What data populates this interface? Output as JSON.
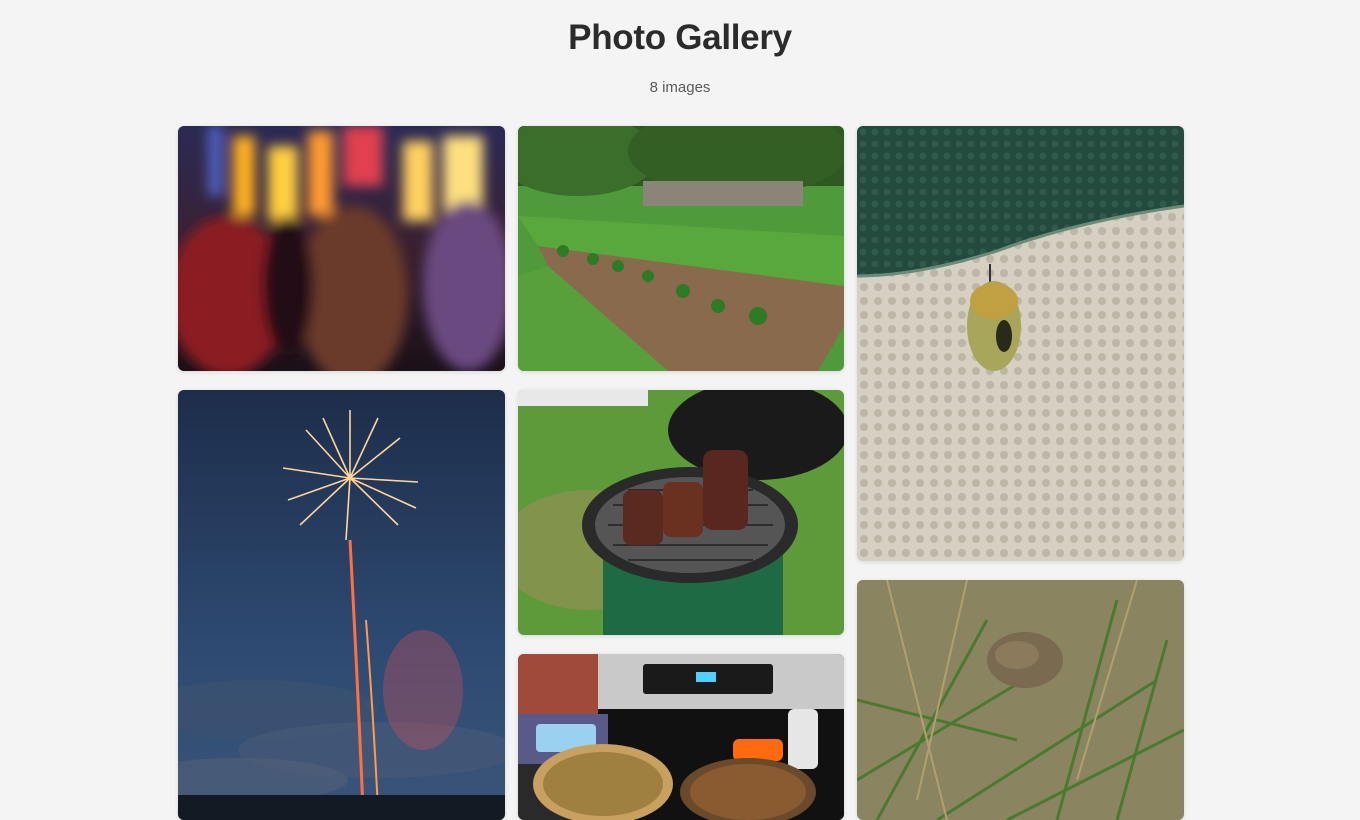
{
  "page": {
    "title": "Photo Gallery",
    "image_count_label": "8 images"
  },
  "gallery": {
    "images": [
      {
        "subject": "blurred-concert-lights"
      },
      {
        "subject": "vegetable-garden-rows"
      },
      {
        "subject": "chrysalis-on-textured-surface"
      },
      {
        "subject": "fireworks-at-dusk"
      },
      {
        "subject": "ribs-on-green-kamado-grill"
      },
      {
        "subject": "toad-in-grass"
      },
      {
        "subject": "pizzas-on-stovetop"
      }
    ]
  },
  "colors": {
    "background": "#f4f4f4",
    "title": "#2b2b2b",
    "subtitle": "#5a5a5a"
  }
}
